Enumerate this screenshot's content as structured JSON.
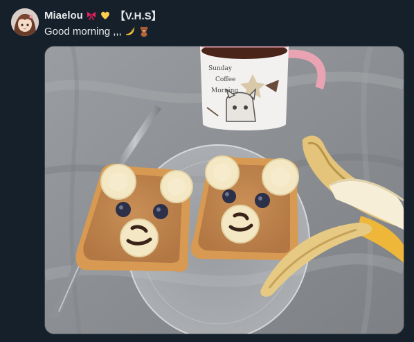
{
  "tweet": {
    "author_name": "Miaelou",
    "name_emojis": [
      "ribbon-emoji",
      "yellow-heart-emoji"
    ],
    "name_tag": "【V.H.S】",
    "text": "Good morning ,,,",
    "text_emojis": [
      "banana-emoji",
      "teddy-bear-emoji"
    ],
    "mug_text": [
      "Sunday",
      "Coffee",
      "Morning"
    ]
  }
}
